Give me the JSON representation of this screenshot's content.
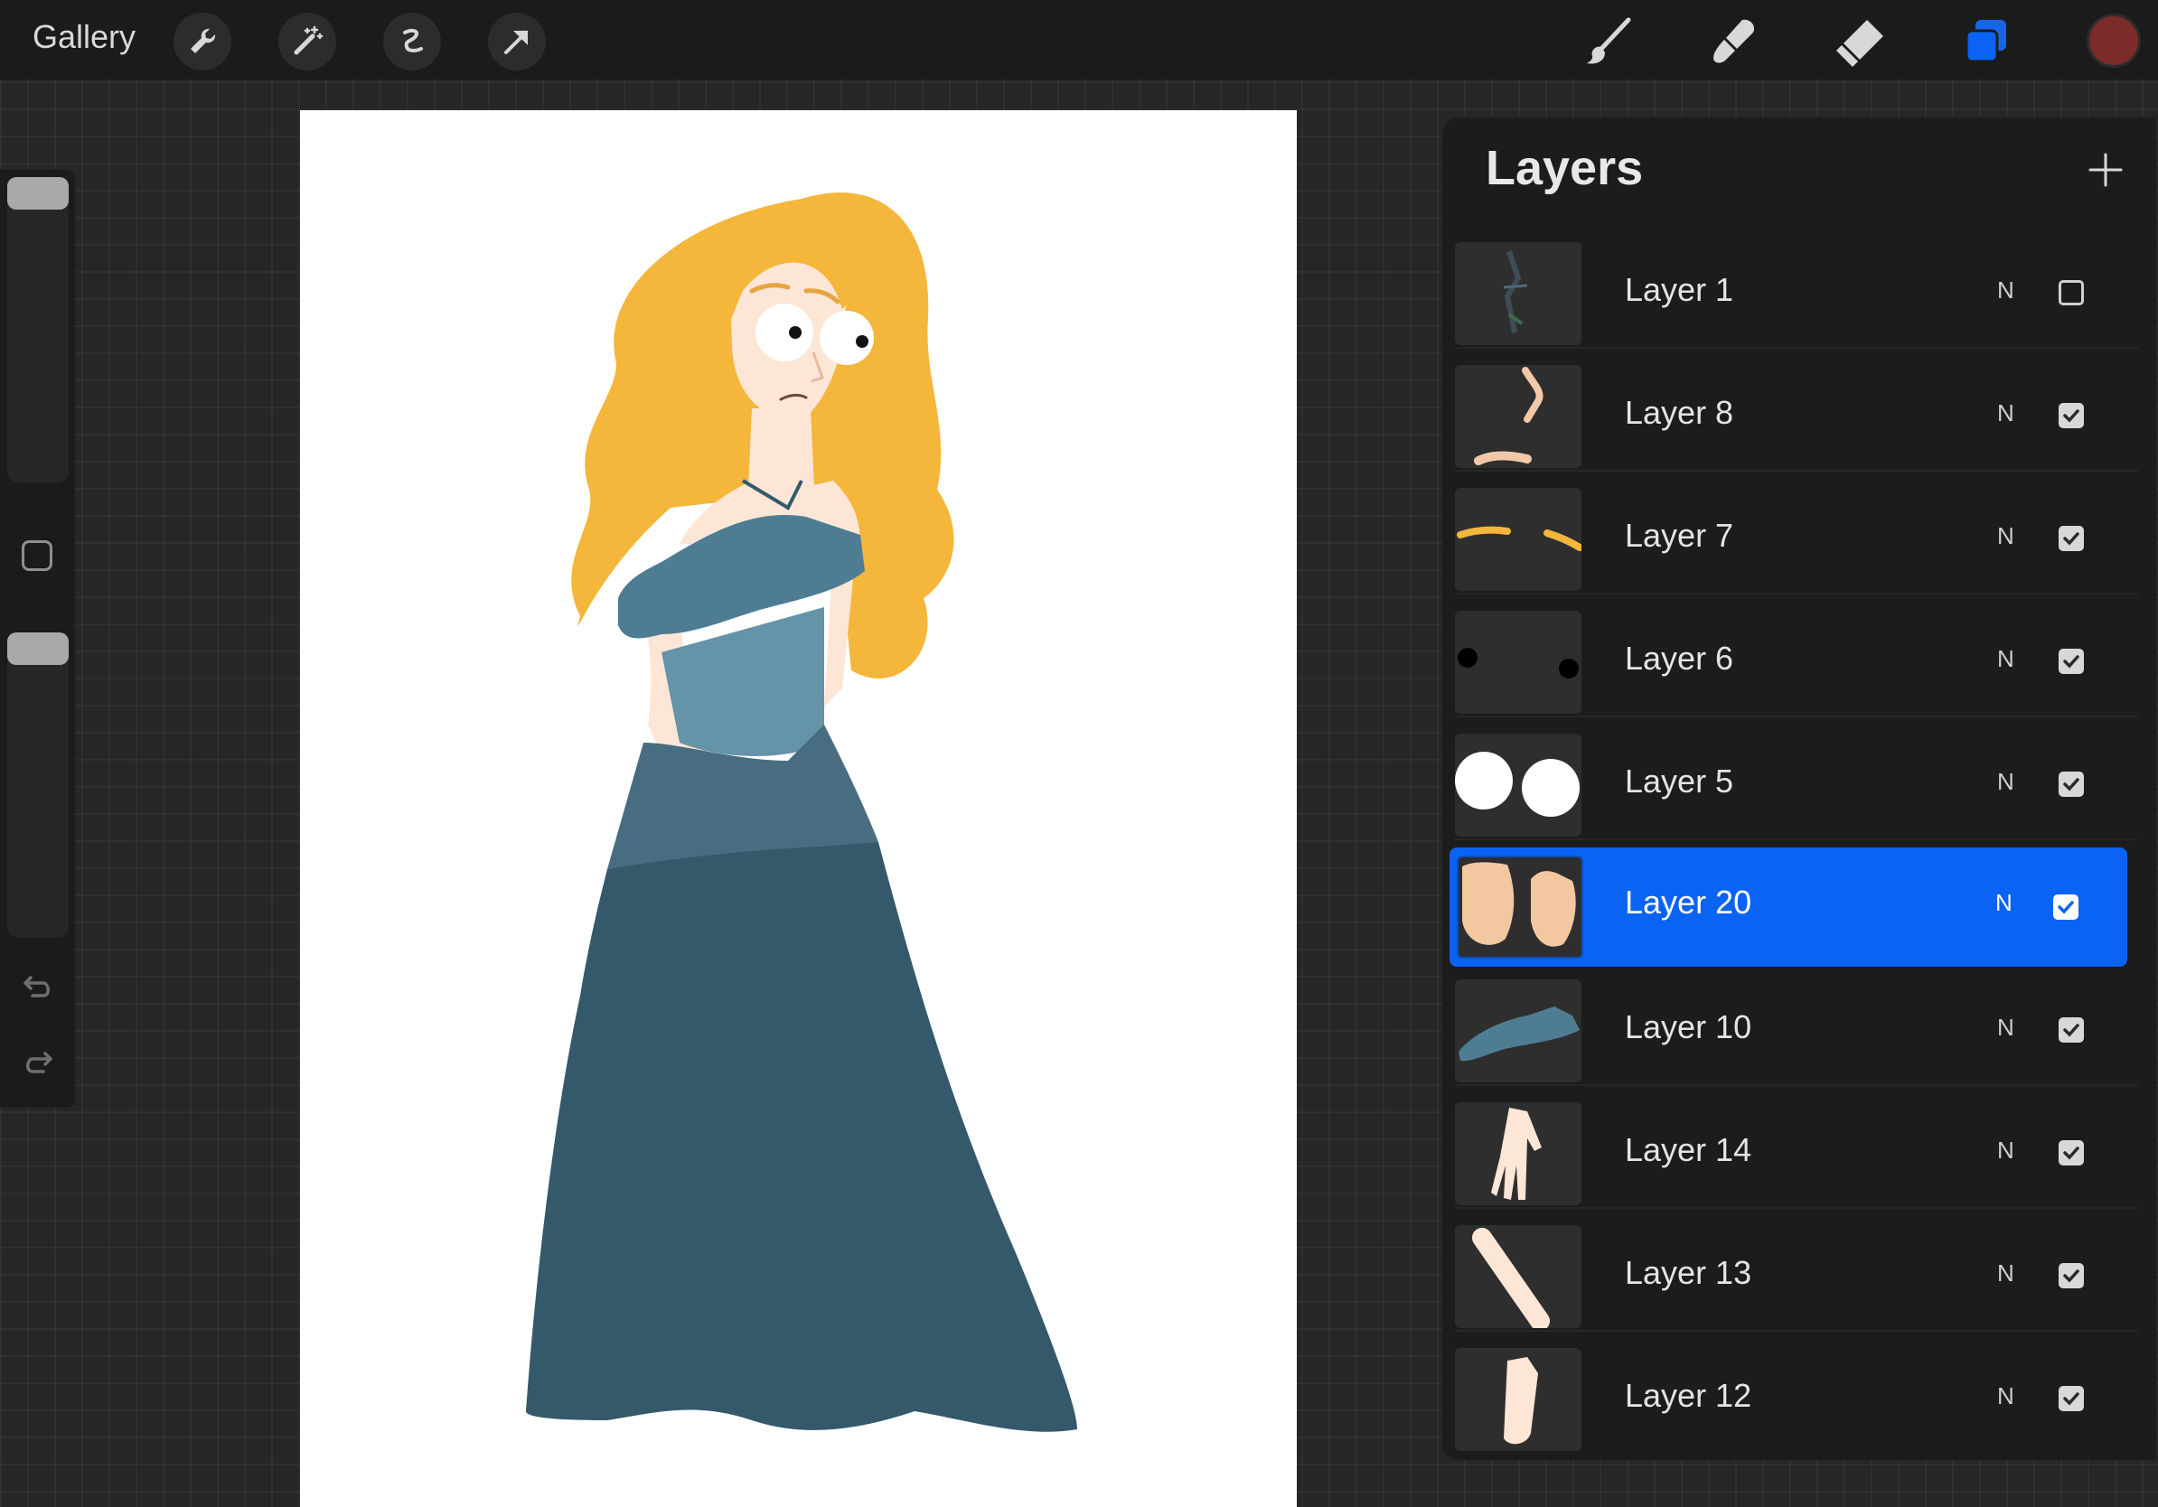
{
  "app": {
    "gallery_label": "Gallery",
    "top_icons": [
      "wrench-icon",
      "magic-wand-icon",
      "selection-icon",
      "transform-arrow-icon"
    ],
    "right_tools": [
      "brush-icon",
      "smudge-icon",
      "eraser-icon",
      "layers-icon"
    ],
    "current_color": "#7d2b29",
    "accent_color": "#0a63f2"
  },
  "sidebar": {
    "brush_size_level": 0.0,
    "opacity_level": 0.0,
    "icons": [
      "modify-square-icon",
      "undo-icon",
      "redo-icon"
    ]
  },
  "layers": {
    "title": "Layers",
    "add_icon": "plus-icon",
    "items": [
      {
        "name": "Layer 1",
        "blend": "N",
        "visible": false,
        "selected": false
      },
      {
        "name": "Layer 8",
        "blend": "N",
        "visible": true,
        "selected": false
      },
      {
        "name": "Layer 7",
        "blend": "N",
        "visible": true,
        "selected": false
      },
      {
        "name": "Layer 6",
        "blend": "N",
        "visible": true,
        "selected": false
      },
      {
        "name": "Layer 5",
        "blend": "N",
        "visible": true,
        "selected": false
      },
      {
        "name": "Layer 20",
        "blend": "N",
        "visible": true,
        "selected": true
      },
      {
        "name": "Layer 10",
        "blend": "N",
        "visible": true,
        "selected": false
      },
      {
        "name": "Layer 14",
        "blend": "N",
        "visible": true,
        "selected": false
      },
      {
        "name": "Layer 13",
        "blend": "N",
        "visible": true,
        "selected": false
      },
      {
        "name": "Layer 12",
        "blend": "N",
        "visible": true,
        "selected": false
      }
    ]
  },
  "artwork": {
    "hair_color": "#f4b63b",
    "skin_color": "#fde6d6",
    "dress_color": "#33596a",
    "bodice_color": "#6593a8"
  }
}
